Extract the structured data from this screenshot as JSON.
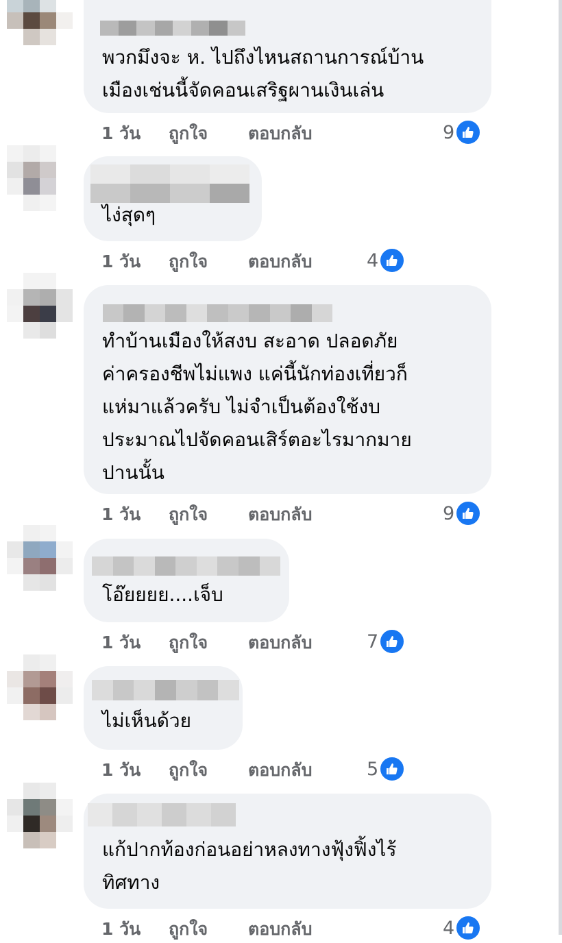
{
  "comments": [
    {
      "text": "พวกมึงจะ ห. ไปถึงไหนสถานการณ์บ้าน\nเมืองเช่นนี้จัดคอนเสริฐผานเงินเล่น",
      "time": "1 วัน",
      "like_label": "ถูกใจ",
      "reply_label": "ตอบกลับ",
      "reaction_count": "9"
    },
    {
      "text": "ไง่สุดๆ",
      "time": "1 วัน",
      "like_label": "ถูกใจ",
      "reply_label": "ตอบกลับ",
      "reaction_count": "4"
    },
    {
      "text": "ทำบ้านเมืองให้สงบ สะอาด ปลอดภัย\nค่าครองชีพไม่แพง แค่นี้นักท่องเที่ยวก็\nแห่มาแล้วครับ ไม่จำเป็นต้องใช้งบ\nประมาณไปจัดคอนเสิร์ตอะไรมากมาย\nปานนั้น",
      "time": "1 วัน",
      "like_label": "ถูกใจ",
      "reply_label": "ตอบกลับ",
      "reaction_count": "9"
    },
    {
      "text": "โอ๊ยยยย....เจ็บ",
      "time": "1 วัน",
      "like_label": "ถูกใจ",
      "reply_label": "ตอบกลับ",
      "reaction_count": "7"
    },
    {
      "text": "ไม่เห็นด้วย",
      "time": "1 วัน",
      "like_label": "ถูกใจ",
      "reply_label": "ตอบกลับ",
      "reaction_count": "5"
    },
    {
      "text": "แก้ปากท้องก่อนอย่าหลงทางฟุ้งฟิ้งไร้\nทิศทาง",
      "time": "1 วัน",
      "like_label": "ถูกใจ",
      "reply_label": "ตอบกลับ",
      "reaction_count": "4"
    }
  ],
  "icons": {
    "reaction": "like-thumbs-up-icon",
    "avatar": "blurred-avatar"
  },
  "colors": {
    "bubble": "#f0f2f5",
    "like_blue": "#1877f2",
    "meta_text": "#65676b",
    "body_text": "#050505"
  }
}
